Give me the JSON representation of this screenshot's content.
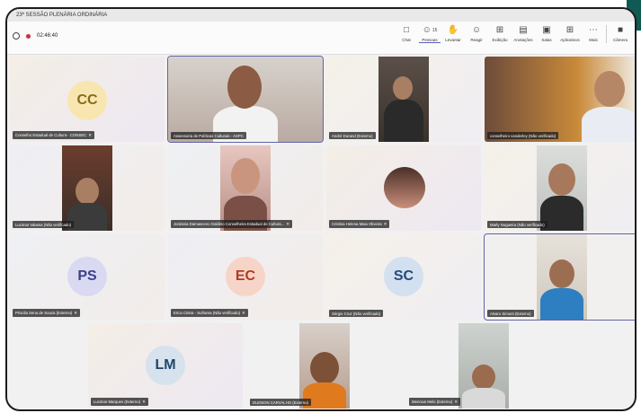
{
  "window": {
    "title": "23ª SESSÃO PLENÁRIA ORDINÁRIA"
  },
  "status": {
    "timer": "02:46:40"
  },
  "toolbar": {
    "items": [
      {
        "label": "Chat",
        "icon": "chat-icon"
      },
      {
        "label": "Pessoas",
        "icon": "people-icon",
        "count": "15"
      },
      {
        "label": "Levantar",
        "icon": "raise-hand-icon"
      },
      {
        "label": "Reagir",
        "icon": "react-icon"
      },
      {
        "label": "Exibição",
        "icon": "view-icon"
      },
      {
        "label": "Anotações",
        "icon": "notes-icon"
      },
      {
        "label": "Salas",
        "icon": "rooms-icon"
      },
      {
        "label": "Aplicativos",
        "icon": "apps-icon"
      },
      {
        "label": "Mais",
        "icon": "more-icon"
      },
      {
        "label": "Câmera",
        "icon": "camera-icon"
      }
    ]
  },
  "participants": [
    {
      "name": "Conselho Estadual de Cultura - CONSEC",
      "initials": "CC",
      "initials_color": "#8a6a18",
      "avatar_bg": "#f8e6b0"
    },
    {
      "name": "Assessoria de Políticas Culturais - ASPC"
    },
    {
      "name": "André Durand (Externo)"
    },
    {
      "name": "conselheiro vanderley (Não verificado)"
    },
    {
      "name": "Lucimar Iokama (Não verificado)"
    },
    {
      "name": "Jordania Damasceno Galdino Conselheira Estadual de Cultura..."
    },
    {
      "name": "Cristina Helena Maia Oliveira"
    },
    {
      "name": "Marly Nogueira (Não verificado)"
    },
    {
      "name": "Priscila Sena de Souza (Externo)",
      "initials": "PS",
      "initials_color": "#3b3f8c",
      "avatar_bg": "#d9daf1"
    },
    {
      "name": "Erica Cintra - Suframa (Não verificado)",
      "initials": "EC",
      "initials_color": "#b13a22",
      "avatar_bg": "#f7d4c8"
    },
    {
      "name": "Sérgio Cruz (Não verificado)",
      "initials": "SC",
      "initials_color": "#234b7d",
      "avatar_bg": "#d3e0ef"
    },
    {
      "name": "Alvaro Simont (Externo)"
    },
    {
      "name": "Lucimar Marques (Externo)",
      "initials": "LM",
      "initials_color": "#22466a",
      "avatar_bg": "#d6e2ee"
    },
    {
      "name": "DUDSON CARVALHO (Externo)"
    },
    {
      "name": "Mencius Melo (Externo)"
    }
  ]
}
